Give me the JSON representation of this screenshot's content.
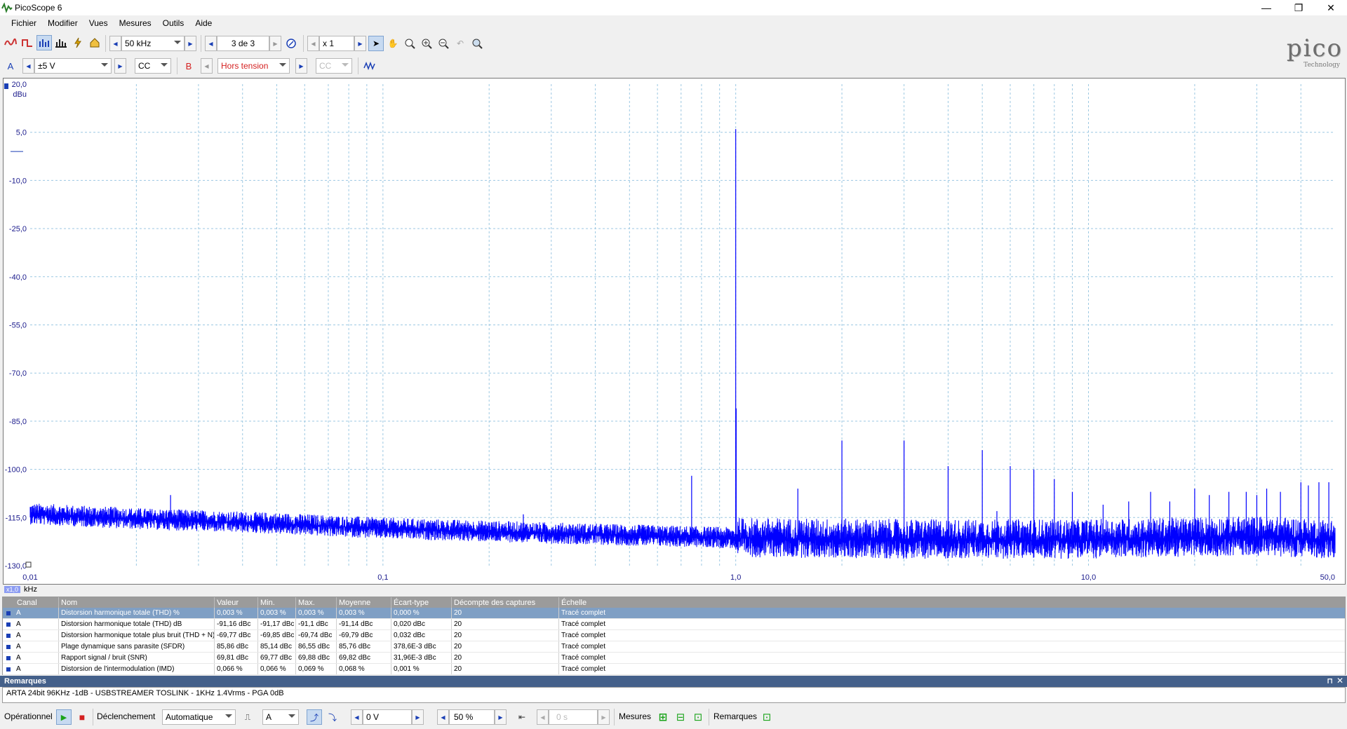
{
  "window": {
    "title": "PicoScope 6",
    "minimize": "—",
    "restore": "❐",
    "close": "✕"
  },
  "menu": [
    "Fichier",
    "Modifier",
    "Vues",
    "Mesures",
    "Outils",
    "Aide"
  ],
  "toolbar": {
    "timebase": "50 kHz",
    "capture": "3 de 3",
    "zoom": "x 1"
  },
  "channels": {
    "a_label": "A",
    "a_range": "±5 V",
    "a_coupling": "CC",
    "b_label": "B",
    "b_range": "Hors tension",
    "b_coupling": "CC"
  },
  "logo": {
    "word": "pico",
    "sub": "Technology"
  },
  "colors": {
    "trace": "#0000ff",
    "grid": "#9cc8e2",
    "header": "#44608a",
    "selected_row": "#7f9fc4"
  },
  "chart_data": {
    "type": "line",
    "ylabel": "dBu",
    "xunit": "kHz",
    "xscale": "log",
    "xlim": [
      0.01,
      50
    ],
    "ylim": [
      -130,
      20
    ],
    "y_ticks": [
      "20,0",
      "5,0",
      "-10,0",
      "-25,0",
      "-40,0",
      "-55,0",
      "-70,0",
      "-85,0",
      "-100,0",
      "-115,0",
      "-130,0"
    ],
    "x_ticks": [
      {
        "v": 0.01,
        "label": "0,01"
      },
      {
        "v": 0.1,
        "label": "0,1"
      },
      {
        "v": 1.0,
        "label": "1,0"
      },
      {
        "v": 10.0,
        "label": "10,0"
      },
      {
        "v": 50.0,
        "label": "50,0"
      }
    ],
    "zoom_badge": "x1,0",
    "series": [
      {
        "noise_floor": [
          [
            0.01,
            -114
          ],
          [
            0.02,
            -115.5
          ],
          [
            0.05,
            -117
          ],
          [
            0.1,
            -118.5
          ],
          [
            0.3,
            -120
          ],
          [
            1.0,
            -121.5
          ],
          [
            3.0,
            -122
          ],
          [
            10.0,
            -122
          ],
          [
            30.0,
            -121
          ],
          [
            50.0,
            -122
          ]
        ],
        "peaks": [
          [
            0.025,
            -108
          ],
          [
            0.25,
            -114
          ],
          [
            0.75,
            -102
          ],
          [
            1.0,
            6
          ],
          [
            1.003,
            -81
          ],
          [
            1.5,
            -106
          ],
          [
            2.0,
            -91
          ],
          [
            3.0,
            -91
          ],
          [
            4.0,
            -99
          ],
          [
            5.0,
            -94
          ],
          [
            5.5,
            -113
          ],
          [
            6.0,
            -99
          ],
          [
            7.0,
            -100
          ],
          [
            8.0,
            -103
          ],
          [
            9.0,
            -107
          ],
          [
            11.0,
            -111
          ],
          [
            13.0,
            -110
          ],
          [
            15.0,
            -107
          ],
          [
            17.0,
            -110
          ],
          [
            20.0,
            -106
          ],
          [
            22.0,
            -108
          ],
          [
            25.0,
            -107
          ],
          [
            28.0,
            -107
          ],
          [
            30.0,
            -108
          ],
          [
            32.0,
            -106
          ],
          [
            35.0,
            -107
          ],
          [
            40.0,
            -104
          ],
          [
            42.0,
            -105
          ],
          [
            45.0,
            -104
          ],
          [
            48.0,
            -104
          ]
        ]
      }
    ]
  },
  "measurements": {
    "headers": [
      "Canal",
      "Nom",
      "Valeur",
      "Min.",
      "Max.",
      "Moyenne",
      "Écart-type",
      "Décompte des captures",
      "Échelle"
    ],
    "rows": [
      [
        "A",
        "Distorsion harmonique totale (THD) %",
        "0,003 %",
        "0,003 %",
        "0,003 %",
        "0,003 %",
        "0,000 %",
        "20",
        "Tracé complet"
      ],
      [
        "A",
        "Distorsion harmonique totale (THD) dB",
        "-91,16 dBc",
        "-91,17 dBc",
        "-91,1 dBc",
        "-91,14 dBc",
        "0,020 dBc",
        "20",
        "Tracé complet"
      ],
      [
        "A",
        "Distorsion harmonique totale plus bruit (THD + N)",
        "-69,77 dBc",
        "-69,85 dBc",
        "-69,74 dBc",
        "-69,79 dBc",
        "0,032 dBc",
        "20",
        "Tracé complet"
      ],
      [
        "A",
        "Plage dynamique sans parasite (SFDR)",
        "85,86 dBc",
        "85,14 dBc",
        "86,55 dBc",
        "85,76 dBc",
        "378,6E-3 dBc",
        "20",
        "Tracé complet"
      ],
      [
        "A",
        "Rapport signal / bruit (SNR)",
        "69,81 dBc",
        "69,77 dBc",
        "69,88 dBc",
        "69,82 dBc",
        "31,96E-3 dBc",
        "20",
        "Tracé complet"
      ],
      [
        "A",
        "Distorsion de l'intermodulation (IMD)",
        "0,066 %",
        "0,066 %",
        "0,069 %",
        "0,068 %",
        "0,001 %",
        "20",
        "Tracé complet"
      ]
    ]
  },
  "remarks": {
    "title": "Remarques",
    "text": "ARTA 24bit 96KHz -1dB - USBSTREAMER TOSLINK - 1KHz 1.4Vrms - PGA 0dB"
  },
  "statusbar": {
    "run_label": "Opérationnel",
    "trigger_label": "Déclenchement",
    "trigger_mode": "Automatique",
    "trigger_channel": "A",
    "trigger_level": "0 V",
    "pretrigger": "50 %",
    "delay": "0 s",
    "measures_label": "Mesures",
    "notes_label": "Remarques"
  }
}
